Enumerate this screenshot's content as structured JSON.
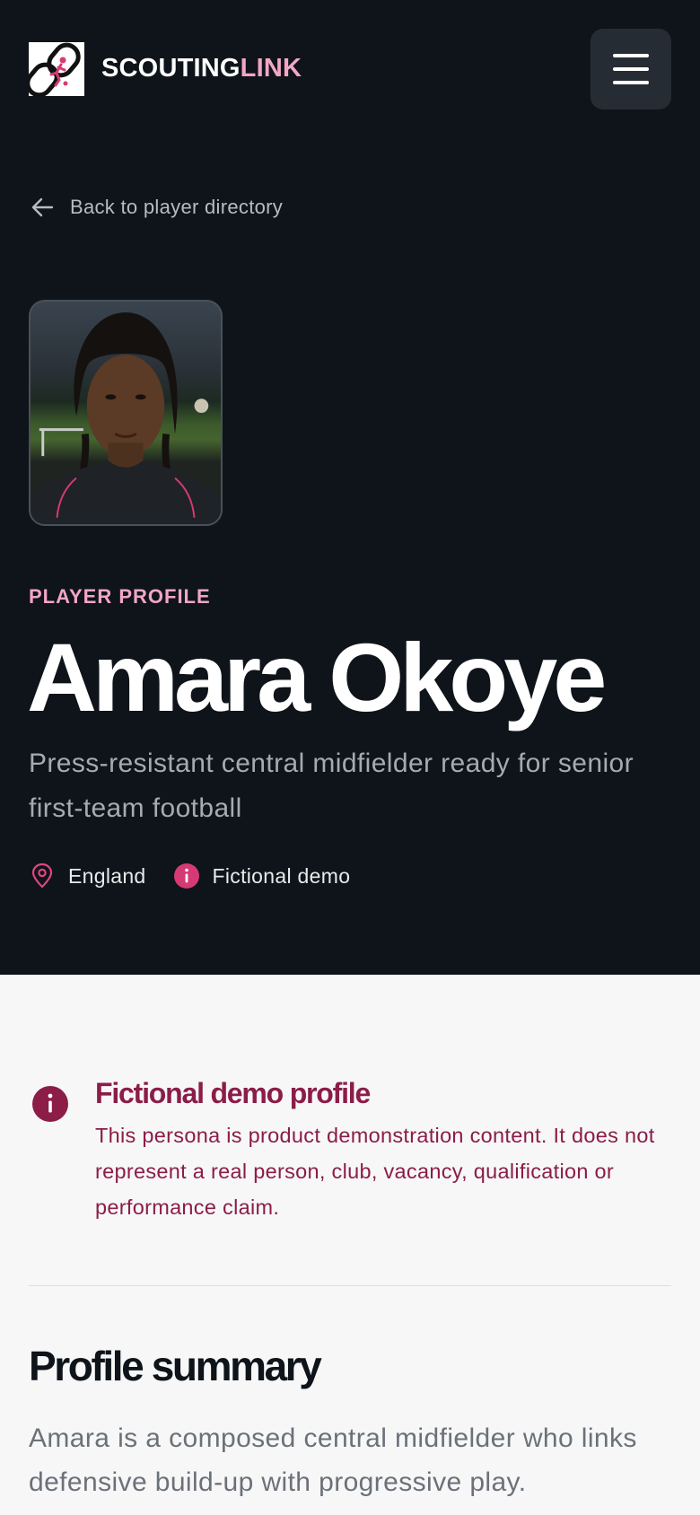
{
  "header": {
    "brand_primary": "SCOUTING",
    "brand_accent": "LINK",
    "logo_icon": "chain-link-runner-icon",
    "menu_icon": "hamburger-menu-icon"
  },
  "nav": {
    "back_label": "Back to player directory",
    "back_icon": "arrow-left-icon"
  },
  "profile": {
    "eyebrow": "PLAYER PROFILE",
    "name": "Amara Okoye",
    "tagline": "Press-resistant central midfielder ready for senior first-team football",
    "meta": [
      {
        "icon": "location-pin-icon",
        "label": "England"
      },
      {
        "icon": "info-icon",
        "label": "Fictional demo"
      }
    ]
  },
  "notice": {
    "icon": "info-icon",
    "title": "Fictional demo profile",
    "body": "This persona is product demonstration content. It does not represent a real person, club, vacancy, qualification or performance claim."
  },
  "summary": {
    "title": "Profile summary",
    "body": "Amara is a composed central midfielder who links defensive build-up with progressive play."
  },
  "colors": {
    "hero_bg": "#0e1419",
    "accent_pink": "#f2a6c4",
    "notice_red": "#8b1d47",
    "pin_pink": "#e0457f",
    "page_bg": "#f7f7f8"
  }
}
